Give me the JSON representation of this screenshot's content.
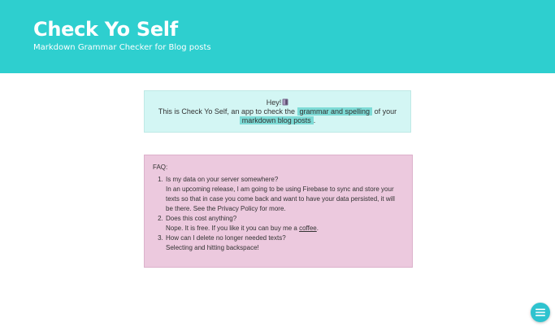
{
  "header": {
    "title": "Check Yo Self",
    "subtitle": "Markdown Grammar Checker for Blog posts",
    "background_color": "#2ecfcf"
  },
  "intro": {
    "greeting": "Hey!",
    "greeting_icon": "book-icon",
    "text_before": "This is Check Yo Self, an app to check the",
    "highlight_1": "grammar and spelling",
    "text_middle": "of your",
    "highlight_2": "markdown blog posts",
    "text_after": ".",
    "background_color": "#d3f6f4",
    "highlight_color": "#7ddbd6"
  },
  "faq": {
    "title": "FAQ:",
    "background_color": "#ecc9de",
    "items": [
      {
        "question": "Is my data on your server somewhere?",
        "answer": "In an upcoming release, I am going to be using Firebase to sync and store your texts so that in case you come back and want to have your data persisted, it will be there. See the Privacy Policy for more."
      },
      {
        "question": "Does this cost anything?",
        "answer_before": "Nope. It is free. If you like it you can buy me a",
        "answer_link": "coffee",
        "answer_after": "."
      },
      {
        "question": "How can I delete no longer needed texts?",
        "answer": "Selecting and hitting backspace!"
      }
    ]
  },
  "menu_button": {
    "icon": "hamburger-menu-icon",
    "color": "#2ec3cf"
  }
}
